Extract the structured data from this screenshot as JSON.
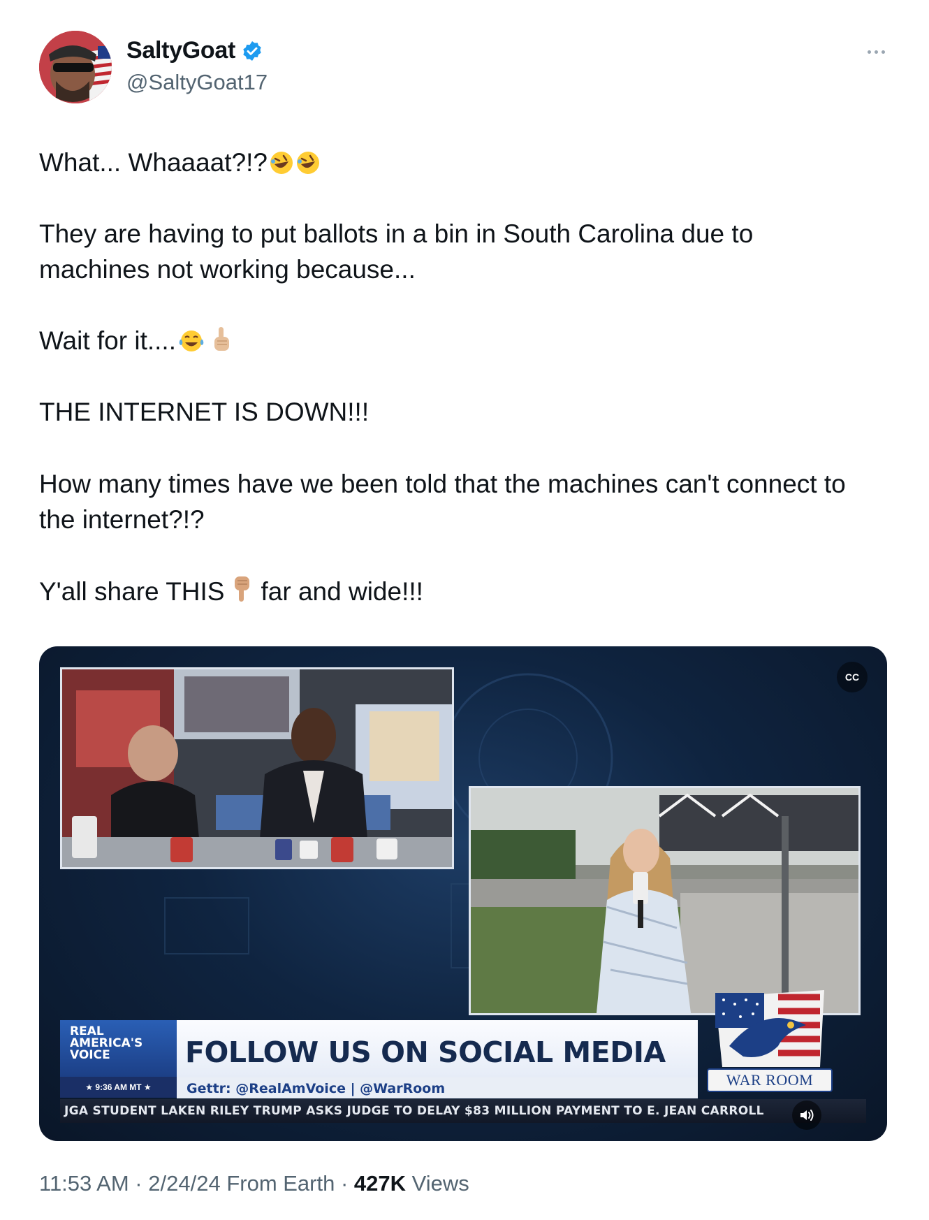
{
  "author": {
    "display_name": "SaltyGoat",
    "handle": "@SaltyGoat17",
    "verified": true
  },
  "tweet": {
    "line1": "What... Whaaaat?!?",
    "line2a": "They are having to put ballots in a bin in South Carolina due to",
    "line2b": "machines not working because...",
    "line3": "Wait for it....",
    "line4": "THE INTERNET IS DOWN!!!",
    "line5a": "How many times have we been told that the machines can't connect to",
    "line5b": "the internet?!?",
    "line6a": "Y'all share THIS",
    "line6b": "far and wide!!!"
  },
  "video": {
    "brand": "REAL AMERICA'S VOICE",
    "time": "★ 9:36 AM MT ★",
    "headline": "FOLLOW US ON SOCIAL MEDIA",
    "subline": "Gettr: @RealAmVoice | @WarRoom",
    "logo_label": "WAR ROOM",
    "ticker": "JGA STUDENT LAKEN RILEY        TRUMP ASKS JUDGE TO DELAY $83 MILLION PAYMENT TO E. JEAN CARROLL",
    "cc_label": "CC"
  },
  "footer": {
    "time": "11:53 AM",
    "date": "2/24/24",
    "source": "From Earth",
    "views_count": "427K",
    "views_label": "Views"
  },
  "colors": {
    "text": "#0f1419",
    "secondary": "#536471",
    "verified": "#1d9bf0"
  }
}
